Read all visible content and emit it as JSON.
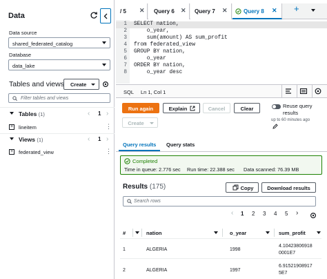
{
  "left_panel": {
    "title": "Data",
    "data_source_label": "Data source",
    "data_source_value": "shared_federated_catalog",
    "database_label": "Database",
    "database_value": "data_lake",
    "tables_views_title": "Tables and views",
    "create_label": "Create",
    "filter_placeholder": "Filter tables and views",
    "tables": {
      "label": "Tables",
      "count": "(1)",
      "page": "1",
      "items": [
        {
          "name": "lineitem"
        }
      ]
    },
    "views": {
      "label": "Views",
      "count": "(1)",
      "page": "1",
      "items": [
        {
          "name": "federated_view"
        }
      ]
    }
  },
  "tabs": [
    {
      "label": "/ 5"
    },
    {
      "label": "Query 6"
    },
    {
      "label": "Query 7"
    },
    {
      "label": "Query 8",
      "active": true
    }
  ],
  "editor": {
    "lines": [
      {
        "n": "1",
        "code": "SELECT nation,"
      },
      {
        "n": "2",
        "code": "    o_year,"
      },
      {
        "n": "3",
        "code": "    sum(amount) AS sum_profit"
      },
      {
        "n": "4",
        "code": "from federated_view"
      },
      {
        "n": "5",
        "code": "GROUP BY nation,"
      },
      {
        "n": "6",
        "code": "    o_year"
      },
      {
        "n": "7",
        "code": "ORDER BY nation,"
      },
      {
        "n": "8",
        "code": "    o_year desc"
      }
    ]
  },
  "status": {
    "language": "SQL",
    "position": "Ln 1, Col 1"
  },
  "actions": {
    "run_again": "Run again",
    "explain": "Explain",
    "cancel": "Cancel",
    "clear": "Clear",
    "create": "Create",
    "reuse_label": "Reuse query results",
    "reuse_sub": "up to 60 minutes ago"
  },
  "subtabs": {
    "results": "Query results",
    "stats": "Query stats"
  },
  "completion": {
    "status": "Completed",
    "time_in_queue": "Time in queue: 2.776 sec",
    "run_time": "Run time: 22.388 sec",
    "data_scanned": "Data scanned: 76.39 MB"
  },
  "results": {
    "title": "Results",
    "count": "(175)",
    "copy_label": "Copy",
    "download_label": "Download results",
    "search_placeholder": "Search rows",
    "pages": [
      "1",
      "2",
      "3",
      "4",
      "5"
    ],
    "columns": [
      "#",
      "nation",
      "o_year",
      "sum_profit"
    ],
    "rows": [
      {
        "num": "1",
        "nation": "ALGERIA",
        "o_year": "1998",
        "sum_profit_1": "4.10423806918",
        "sum_profit_2": "0001E7"
      },
      {
        "num": "2",
        "nation": "ALGERIA",
        "o_year": "1997",
        "sum_profit_1": "6.91521908917",
        "sum_profit_2": "5E7"
      }
    ]
  },
  "colors": {
    "primary": "#ec7211",
    "link": "#0073bb",
    "success": "#1d8102"
  }
}
